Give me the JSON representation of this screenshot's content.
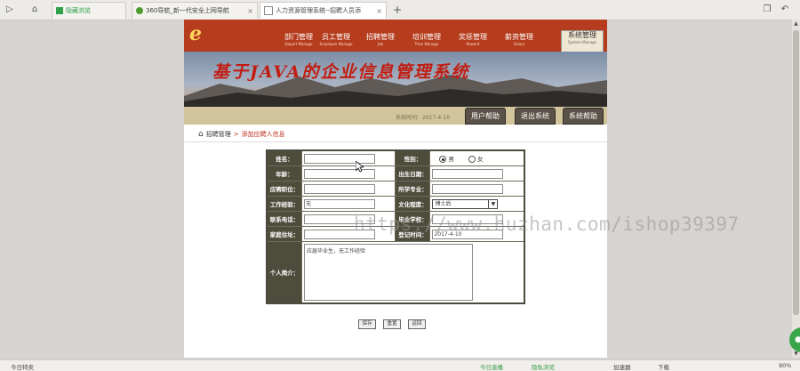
{
  "browser": {
    "tabs": [
      {
        "label": "隐藏浏览",
        "active": false
      },
      {
        "label": "360导航_新一代安全上网导航",
        "active": false
      },
      {
        "label": "人力资源管理系统--招聘人员添",
        "active": true
      }
    ],
    "new_tab": "+"
  },
  "site": {
    "logo": "e",
    "title": "基于JAVA的企业信息管理系统",
    "nav": [
      {
        "label": "部门管理",
        "sub": "Depart Manage"
      },
      {
        "label": "员工管理",
        "sub": "Employee Manage"
      },
      {
        "label": "招聘管理",
        "sub": "Job"
      },
      {
        "label": "培训管理",
        "sub": "Train Manage"
      },
      {
        "label": "奖惩管理",
        "sub": "Reward"
      },
      {
        "label": "薪资管理",
        "sub": "Salary"
      },
      {
        "label": "系统管理",
        "sub": "System Manage"
      }
    ],
    "date_label": "系统时间：2017-4-10",
    "header_buttons": [
      "用户帮助",
      "退出系统",
      "系统帮助"
    ]
  },
  "breadcrumb": {
    "parent": "招聘管理",
    "sep": ">",
    "current": "添加应聘人信息"
  },
  "form": {
    "rows": [
      {
        "l1": "姓名：",
        "v1": "",
        "l2": "性别：",
        "type2": "radio"
      },
      {
        "l1": "年龄：",
        "v1": "",
        "l2": "出生日期：",
        "v2": ""
      },
      {
        "l1": "应聘职位：",
        "v1": "",
        "l2": "所学专业：",
        "v2": ""
      },
      {
        "l1": "工作经验：",
        "v1": "无",
        "l2": "文化程度：",
        "type2": "select"
      },
      {
        "l1": "联系电话：",
        "v1": "",
        "l2": "毕业学校：",
        "v2": ""
      },
      {
        "l1": "家庭住址：",
        "v1": "",
        "l2": "登记时间：",
        "v2": "2017-4-10"
      }
    ],
    "gender": {
      "male": "男",
      "female": "女",
      "selected": "男"
    },
    "education": "博士后",
    "intro_label": "个人简介：",
    "intro_value": "应届毕业生，无工作经验"
  },
  "form_buttons": [
    "保存",
    "重置",
    "返回"
  ],
  "watermark": "https://www.huzhan.com/ishop39397",
  "statusbar": {
    "left": "今日特卖",
    "right": [
      "今日直播",
      "隐私浏览",
      "加速器",
      "下载",
      "90%"
    ]
  }
}
